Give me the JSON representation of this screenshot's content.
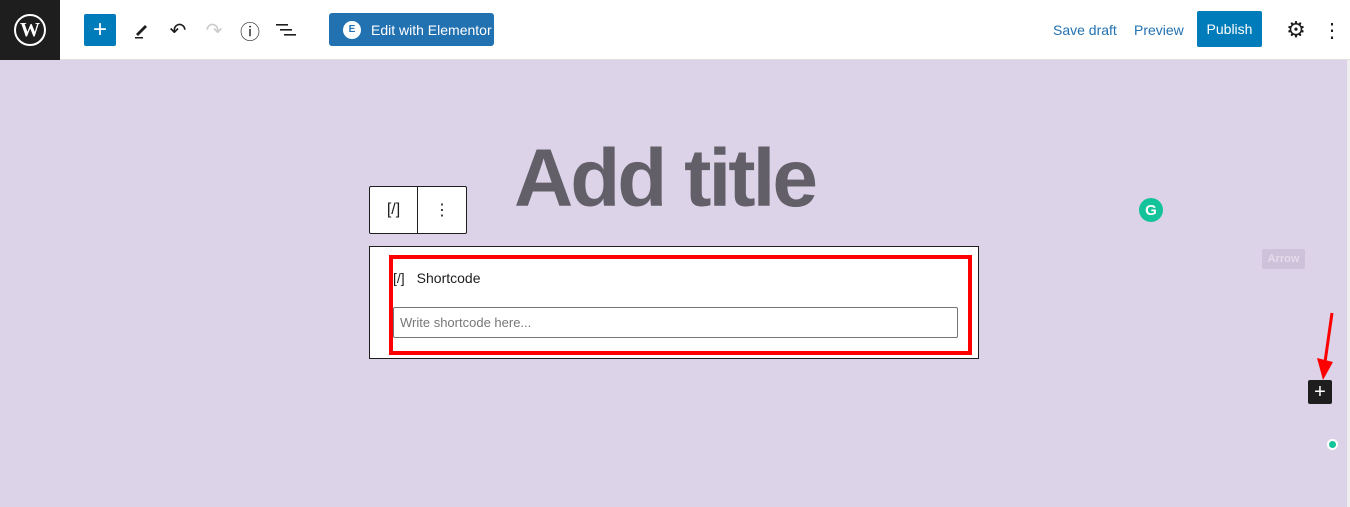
{
  "topbar": {
    "logo": "W",
    "add_label": "+",
    "undo": "↶",
    "redo": "↷",
    "info": "ⓘ",
    "elementor_icon": "E",
    "elementor_label": "Edit with Elementor",
    "save_draft": "Save draft",
    "preview": "Preview",
    "publish": "Publish",
    "settings": "⚙",
    "more": "⋮"
  },
  "editor": {
    "title_placeholder": "Add title",
    "block_toolbar": {
      "icon": "[/]",
      "more": "⋮"
    },
    "shortcode": {
      "icon": "[/]",
      "label": "Shortcode",
      "placeholder": "Write shortcode here...",
      "value": ""
    }
  },
  "overlay": {
    "grammarly": "G",
    "arrow_label": "Arrow",
    "add_block": "+",
    "highlight_color": "#ff0000",
    "accent": "#007cba"
  }
}
